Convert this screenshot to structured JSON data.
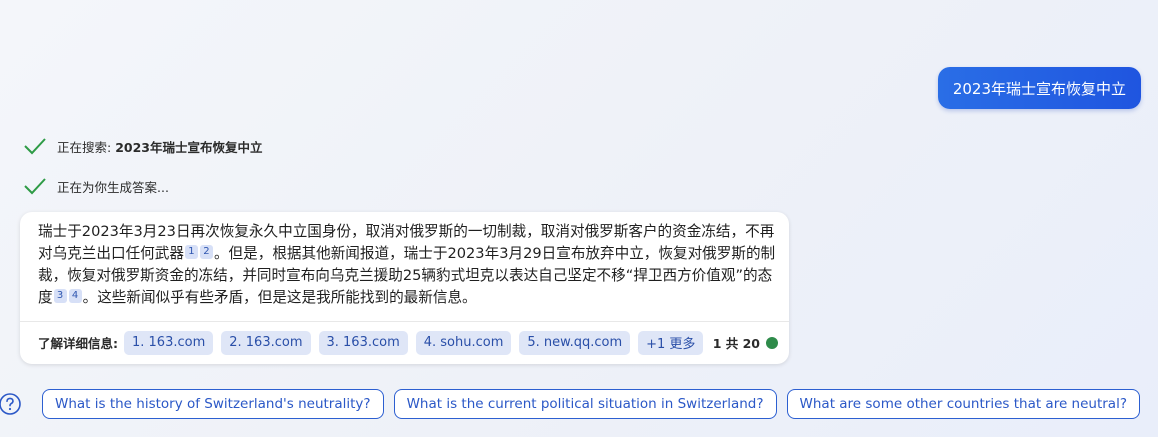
{
  "user_message": "2023年瑞士宣布恢复中立",
  "status": {
    "searching_label": "正在搜索: ",
    "searching_query": "2023年瑞士宣布恢复中立",
    "generating_label": "正在为你生成答案..."
  },
  "answer": {
    "p1": "瑞士于2023年3月23日再次恢复永久中立国身份，取消对俄罗斯的一切制裁，取消对俄罗斯客户的资金冻结，不再对乌克兰出口任何武器",
    "c1": "1",
    "c2": "2",
    "p2": "。但是，根据其他新闻报道，瑞士于2023年3月29日宣布放弃中立，恢复对俄罗斯的制裁，恢复对俄罗斯资金的冻结，并同时宣布向乌克兰援助25辆豹式坦克以表达自己坚定不移“捍卫西方价值观”的态度",
    "c3": "3",
    "c4": "4",
    "p3": "。这些新闻似乎有些矛盾，但是这是我所能找到的最新信息。"
  },
  "sources": {
    "label": "了解详细信息:",
    "items": [
      "1. 163.com",
      "2. 163.com",
      "3. 163.com",
      "4. sohu.com",
      "5. new.qq.com"
    ],
    "more": "+1 更多",
    "count": "1 共 20",
    "status_color": "#2e8b4a"
  },
  "suggestions": [
    "What is the history of Switzerland's neutrality?",
    "What is the current political situation in Switzerland?",
    "What are some other countries that are neutral?"
  ],
  "icons": {
    "check": "check-icon",
    "help": "help-icon"
  },
  "colors": {
    "accent": "#1f55e0",
    "check": "#2e9b46",
    "link": "#2b58c7"
  }
}
